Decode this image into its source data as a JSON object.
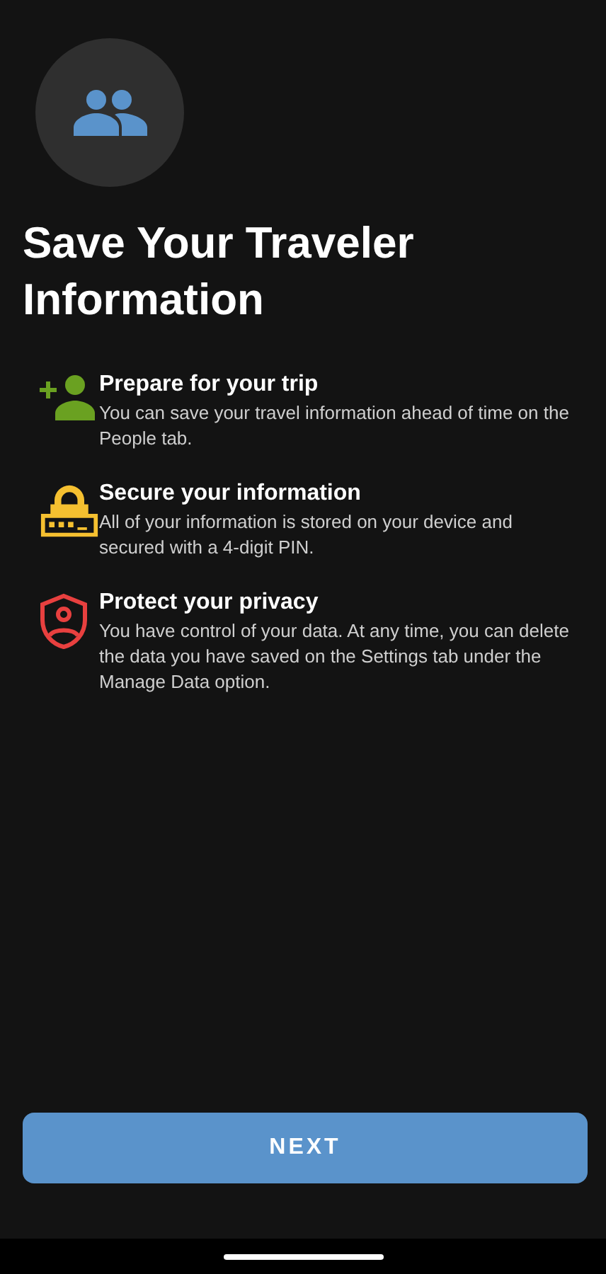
{
  "header": {
    "title": "Save Your Traveler Information"
  },
  "features": [
    {
      "kind": "person-add",
      "color": "#6aa121",
      "title": "Prepare for your trip",
      "text": "You can save your travel information ahead of time on the People tab."
    },
    {
      "kind": "lock-pin",
      "color": "#f5c030",
      "title": "Secure your information",
      "text": "All of your information is stored on your device and secured with a 4-digit PIN."
    },
    {
      "kind": "shield-person",
      "color": "#e8403f",
      "title": "Protect your privacy",
      "text": "You have control of your data. At any time, you can delete the data you have saved on the Settings tab under the Manage Data option."
    }
  ],
  "next_button": {
    "label": "NEXT"
  }
}
